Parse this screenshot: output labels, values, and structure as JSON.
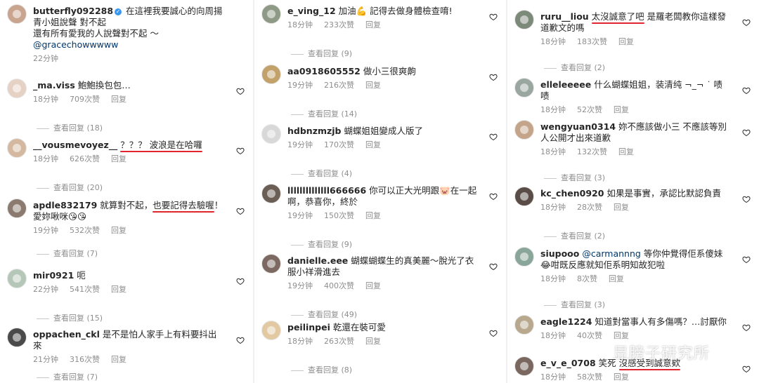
{
  "columns": [
    {
      "comments": [
        {
          "username": "butterfly092288",
          "verified": true,
          "text_parts": [
            {
              "t": "在這裡我要誠心的向周揚青小姐說聲 對不起"
            }
          ],
          "text2": "還有所有愛我的人說聲對不起 ～",
          "mention": "@gracechowwwww",
          "time": "22分钟",
          "likes": "",
          "reply": "",
          "heart": false
        },
        {
          "username": "_ma.viss",
          "text_parts": [
            {
              "t": "鮑鮑換包包…"
            }
          ],
          "time": "18分钟",
          "likes": "709次赞",
          "reply": "回复",
          "heart": true,
          "more": "查看回复 (18)"
        },
        {
          "username": "__vousmevoyez__",
          "text_parts": [
            {
              "t": "？？？ 波浪是在哈囉",
              "hl": true
            }
          ],
          "time": "18分钟",
          "likes": "626次赞",
          "reply": "回复",
          "heart": true,
          "more": "查看回复 (20)"
        },
        {
          "username": "apdle832179",
          "text_parts": [
            {
              "t": "就算對不起，"
            },
            {
              "t": "也要記得去驗喔",
              "hl": true
            },
            {
              "t": "！"
            }
          ],
          "text2": "愛妳啾咪😘😘",
          "time": "19分钟",
          "likes": "532次赞",
          "reply": "回复",
          "heart": true,
          "more": "查看回复 (7)"
        },
        {
          "username": "mir0921",
          "text_parts": [
            {
              "t": "呃"
            }
          ],
          "time": "22分钟",
          "likes": "541次赞",
          "reply": "回复",
          "heart": true,
          "more": "查看回复 (15)"
        },
        {
          "username": "oppachen_ckl",
          "text_parts": [
            {
              "t": "是不是怕人家手上有料要抖出來"
            }
          ],
          "time": "21分钟",
          "likes": "316次赞",
          "reply": "回复",
          "heart": true,
          "more": "查看回复 (7)"
        }
      ]
    },
    {
      "comments": [
        {
          "username": "e_ving_12",
          "text_parts": [
            {
              "t": "加油💪 記得去做身體檢查唷!"
            }
          ],
          "time": "18分钟",
          "likes": "233次赞",
          "reply": "回复",
          "heart": true,
          "more": "查看回复 (9)"
        },
        {
          "username": "aa0918605552",
          "text_parts": [
            {
              "t": "做小三很爽齁"
            }
          ],
          "time": "19分钟",
          "likes": "216次赞",
          "reply": "回复",
          "heart": true,
          "more": "查看回复 (14)"
        },
        {
          "username": "hdbnzmzjb",
          "text_parts": [
            {
              "t": "蝴蝶姐姐變成人版了"
            }
          ],
          "time": "19分钟",
          "likes": "170次赞",
          "reply": "回复",
          "heart": true,
          "more": "查看回复 (4)"
        },
        {
          "username": "llllllllllllll666666",
          "text_parts": [
            {
              "t": "你可以正大光明跟🐷在一起啊，恭喜你，終於"
            }
          ],
          "time": "19分钟",
          "likes": "150次赞",
          "reply": "回复",
          "heart": true,
          "more": "查看回复 (9)"
        },
        {
          "username": "danielle.eee",
          "text_parts": [
            {
              "t": "蝴蝶蝴蝶生的真美麗～脫光了衣服小祥滑進去"
            }
          ],
          "time": "19分钟",
          "likes": "400次赞",
          "reply": "回复",
          "heart": true,
          "more": "查看回复 (49)"
        },
        {
          "username": "peilinpei",
          "text_parts": [
            {
              "t": "乾還在裝可愛"
            }
          ],
          "time": "18分钟",
          "likes": "263次赞",
          "reply": "回复",
          "heart": true,
          "more": "查看回复 (8)"
        }
      ]
    },
    {
      "comments": [
        {
          "username": "ruru__liou",
          "text_parts": [
            {
              "t": "太沒誠意了吧",
              "hl": true
            },
            {
              "t": " 是羅老闆教你這樣發道歉文的嗎"
            }
          ],
          "time": "18分钟",
          "likes": "183次赞",
          "reply": "回复",
          "heart": true,
          "more": "查看回复 (2)"
        },
        {
          "username": "elleleeeee",
          "text_parts": [
            {
              "t": "什么蝴蝶姐姐，装清纯 ¬_¬ ˙ 啧啧"
            }
          ],
          "time": "18分钟",
          "likes": "52次赞",
          "reply": "回复",
          "heart": true
        },
        {
          "username": "wengyuan0314",
          "text_parts": [
            {
              "t": "妳不應該做小三 不應該等別人公開才出來道歉"
            }
          ],
          "time": "18分钟",
          "likes": "132次赞",
          "reply": "回复",
          "heart": true,
          "more": "查看回复 (3)"
        },
        {
          "username": "kc_chen0920",
          "text_parts": [
            {
              "t": "如果是事實，承認比默認負責"
            }
          ],
          "time": "18分钟",
          "likes": "28次赞",
          "reply": "回复",
          "heart": true,
          "more": "查看回复 (2)"
        },
        {
          "username": "siupooo",
          "mention_first": "@carmannng",
          "text_parts": [
            {
              "t": "等你仲覺得佢系傻妹😂咁既反應就知佢系明知故犯啦"
            }
          ],
          "time": "18分钟",
          "likes": "8次赞",
          "reply": "回复",
          "heart": true,
          "more": "查看回复 (3)"
        },
        {
          "username": "eagle1224",
          "text_parts": [
            {
              "t": "知道對當事人有多傷嗎？…討厭你"
            }
          ],
          "time": "18分钟",
          "likes": "40次赞",
          "reply": "回复",
          "heart": true
        },
        {
          "username": "e_v_e_0708",
          "text_parts": [
            {
              "t": "笑死 "
            },
            {
              "t": "沒感受到誠意欸",
              "hl": true
            }
          ],
          "time": "18分钟",
          "likes": "58次赞",
          "reply": "回复",
          "heart": true
        }
      ]
    }
  ],
  "watermark": "显膀子研究所",
  "colors": {
    "text": "#262626",
    "meta": "#8e8e8e",
    "highlight": "#e0262c",
    "mention": "#00376b",
    "verified": "#3897f0"
  }
}
